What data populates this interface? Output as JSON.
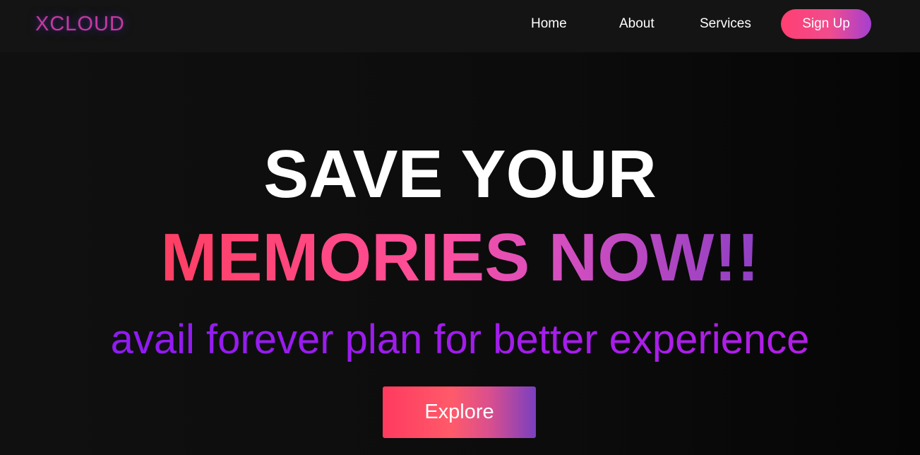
{
  "navbar": {
    "logo": "XCLOUD",
    "links": [
      {
        "label": "Home"
      },
      {
        "label": "About"
      },
      {
        "label": "Services"
      }
    ],
    "signup_label": "Sign Up"
  },
  "hero": {
    "headline_line1": "SAVE YOUR",
    "headline_line2": "MEMORIES NOW!!",
    "subtitle": "avail forever plan for better experience",
    "cta_label": "Explore"
  },
  "colors": {
    "background": "#0e0e0e",
    "navbar_background": "#141414",
    "accent_pink": "#ff3f72",
    "accent_purple": "#8f3fc4",
    "subtitle_purple": "#9b1cf0",
    "logo_pink": "#c9399a"
  }
}
